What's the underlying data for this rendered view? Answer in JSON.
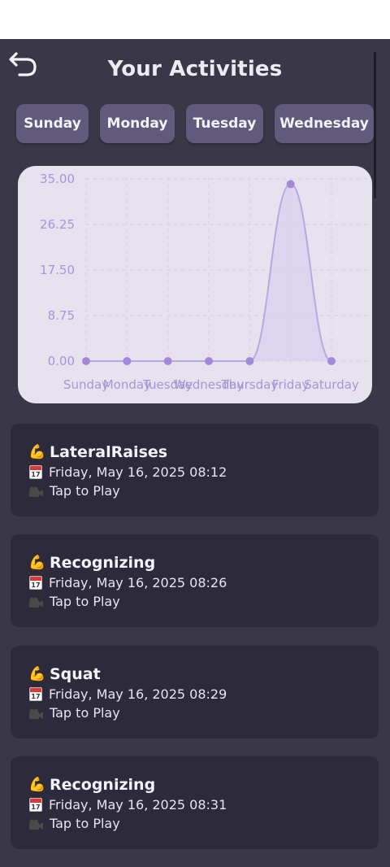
{
  "header": {
    "title": "Your Activities",
    "back_icon": "back-arrow-icon"
  },
  "day_tabs": [
    "Sunday",
    "Monday",
    "Tuesday",
    "Wednesday"
  ],
  "chart_data": {
    "type": "area",
    "categories": [
      "Sunday",
      "Monday",
      "Tuesday",
      "Wednesday",
      "Thursday",
      "Friday",
      "Saturday"
    ],
    "values": [
      0,
      0,
      0,
      0,
      0,
      34,
      0
    ],
    "yticks": [
      "35.00",
      "26.25",
      "17.50",
      "8.75",
      "0.00"
    ],
    "ylim": [
      0,
      35
    ],
    "grid": true,
    "colors": {
      "line": "#b9a7e4",
      "fill": "#d9cff0",
      "point": "#a488d8",
      "label": "#a794d6"
    }
  },
  "activities": [
    {
      "name": "LateralRaises",
      "date": "Friday, May 16, 2025 08:12",
      "action": "Tap to Play"
    },
    {
      "name": "Recognizing",
      "date": "Friday, May 16, 2025 08:26",
      "action": "Tap to Play"
    },
    {
      "name": "Squat",
      "date": "Friday, May 16, 2025 08:29",
      "action": "Tap to Play"
    },
    {
      "name": "Recognizing",
      "date": "Friday, May 16, 2025 08:31",
      "action": "Tap to Play"
    }
  ],
  "icons": {
    "name": "flexed-biceps-icon",
    "date": "calendar-icon",
    "action": "video-camera-icon"
  },
  "calendar_icon_day": "17"
}
